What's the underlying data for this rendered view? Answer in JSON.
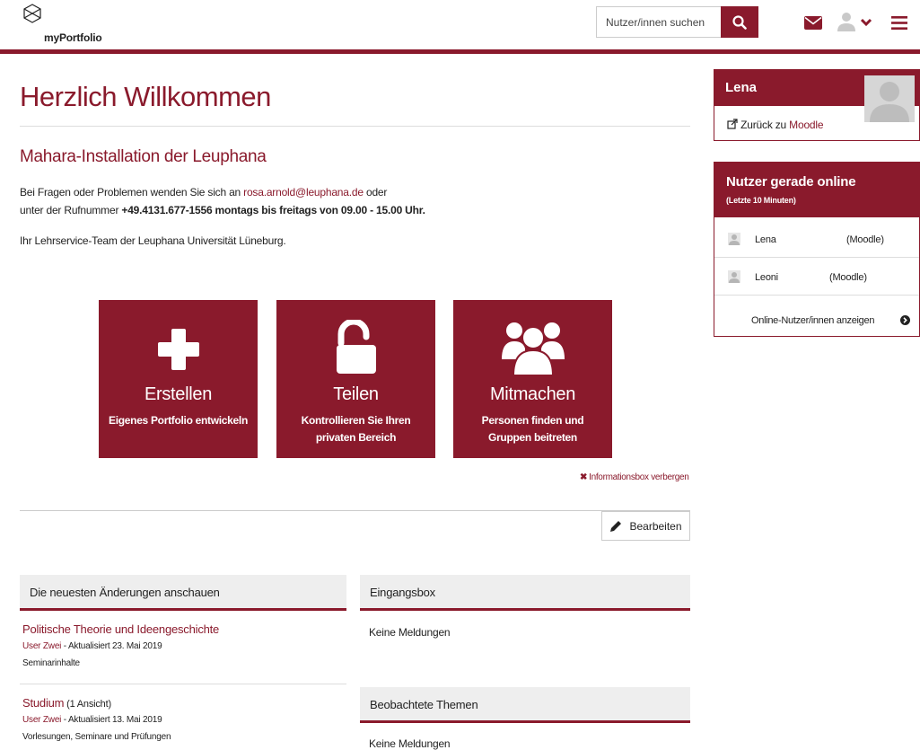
{
  "header": {
    "logo_text": "myPortfolio",
    "search_placeholder": "Nutzer/innen suchen"
  },
  "main": {
    "title": "Herzlich Willkommen",
    "subtitle": "Mahara-Installation der Leuphana",
    "intro_line1_prefix": "Bei Fragen oder Problemen wenden Sie sich an ",
    "intro_email": "rosa.arnold@leuphana.de",
    "intro_line1_suffix": " oder",
    "intro_line2_prefix": "unter der Rufnummer ",
    "intro_line2_bold": "+49.4131.677-1556 montags bis freitags von 09.00 - 15.00 Uhr.",
    "signature": "Ihr Lehrservice-Team der Leuphana Universität Lüneburg.",
    "tiles": [
      {
        "title": "Erstellen",
        "desc": "Eigenes Portfolio entwickeln"
      },
      {
        "title": "Teilen",
        "desc": "Kontrollieren Sie Ihren privaten Bereich"
      },
      {
        "title": "Mitmachen",
        "desc": "Personen finden und Gruppen beitreten"
      }
    ],
    "hide_info": "Informationsbox verbergen",
    "edit_label": "Bearbeiten"
  },
  "recent": {
    "heading": "Die neuesten Änderungen anschauen",
    "items": [
      {
        "title": "Politische Theorie und Ideengeschichte",
        "count": "",
        "author": "User Zwei",
        "meta": " - Aktualisiert 23. Mai 2019",
        "tags": "Seminarinhalte"
      },
      {
        "title": "Studium",
        "count": " (1 Ansicht)",
        "author": "User Zwei",
        "meta": " - Aktualisiert 13. Mai 2019",
        "tags": "Vorlesungen, Seminare und Prüfungen"
      }
    ]
  },
  "inbox": {
    "heading": "Eingangsbox",
    "empty": "Keine Meldungen"
  },
  "watched": {
    "heading": "Beobachtete Themen",
    "empty": "Keine Meldungen"
  },
  "sidebar": {
    "profile": {
      "name": "Lena",
      "back_prefix": "Zurück zu ",
      "back_target": "Moodle"
    },
    "online": {
      "title": "Nutzer gerade online",
      "subtitle": "(Letzte 10 Minuten)",
      "users": [
        {
          "name": "Lena",
          "source": "(Moodle)"
        },
        {
          "name": "Leoni",
          "source": "(Moodle)"
        }
      ],
      "show_all": "Online-Nutzer/innen anzeigen"
    }
  },
  "colors": {
    "accent": "#8a1a2c"
  },
  "icons": [
    "logo-icon",
    "search-icon",
    "mail-icon",
    "user-icon",
    "chevron-down-icon",
    "menu-icon",
    "plus-icon",
    "unlock-icon",
    "group-icon",
    "close-icon",
    "pencil-icon",
    "external-link-icon",
    "arrow-circle-right-icon"
  ]
}
